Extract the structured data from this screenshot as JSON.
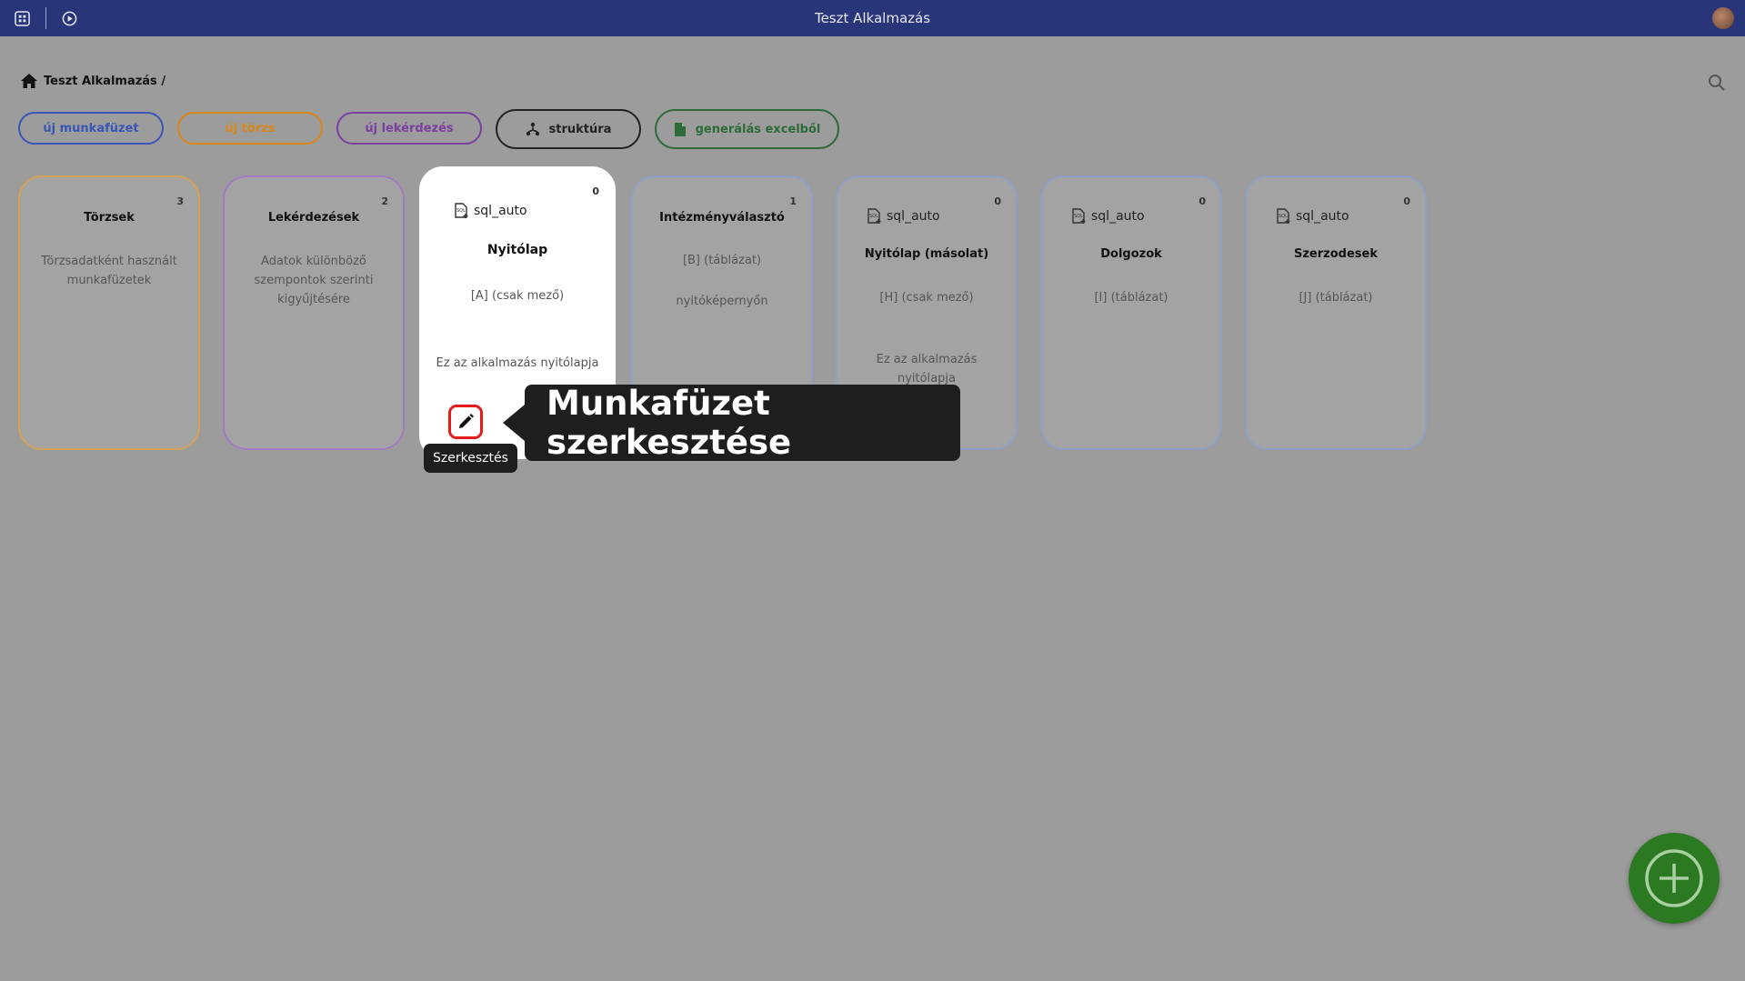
{
  "app": {
    "title": "Teszt Alkalmazás"
  },
  "breadcrumb": {
    "label": "Teszt Alkalmazás /"
  },
  "buttons": {
    "new_workbook": "új munkafüzet",
    "new_master": "új törzs",
    "new_query": "új lekérdezés",
    "structure": "struktúra",
    "generate_excel": "generálás excelből"
  },
  "colors": {
    "topbar": "#283579",
    "blue": "#3a55b5",
    "orange": "#d9861b",
    "purple": "#7b3fa0",
    "dark": "#222222",
    "green": "#2c6a3a",
    "fab": "#2b7a21",
    "highlight": "#e21b1b"
  },
  "cards": [
    {
      "name": "Törzsek",
      "count": "3",
      "desc": "Törzsadatként használt munkafüzetek"
    },
    {
      "name": "Lekérdezések",
      "count": "2",
      "desc": "Adatok különböző szempontok szerinti kigyűjtésére"
    },
    {
      "tag": "sql_auto",
      "name": "Nyitólap",
      "count": "0",
      "field": "[A] (csak mező)",
      "desc": "Ez az alkalmazás nyitólapja"
    },
    {
      "name": "Intézményválasztó",
      "count": "1",
      "field": "[B] (táblázat)",
      "desc": "nyitóképernyőn"
    },
    {
      "tag": "sql_auto",
      "name": "Nyitólap (másolat)",
      "count": "0",
      "field": "[H] (csak mező)",
      "desc": "Ez az alkalmazás nyitólapja"
    },
    {
      "tag": "sql_auto",
      "name": "Dolgozok",
      "count": "0",
      "field": "[I] (táblázat)"
    },
    {
      "tag": "sql_auto",
      "name": "Szerzodesek",
      "count": "0",
      "field": "[J] (táblázat)"
    }
  ],
  "tooltip": {
    "edit": "Szerkesztés"
  },
  "callout": {
    "text": "Munkafüzet szerkesztése"
  },
  "icons": {
    "apps": "apps-icon",
    "play": "play-circle-icon",
    "home": "home-icon",
    "search": "search-icon",
    "structure": "hierarchy-icon",
    "excel": "document-icon",
    "sql": "sql-file-icon",
    "edit": "pencil-icon",
    "add": "plus-circle-icon"
  }
}
